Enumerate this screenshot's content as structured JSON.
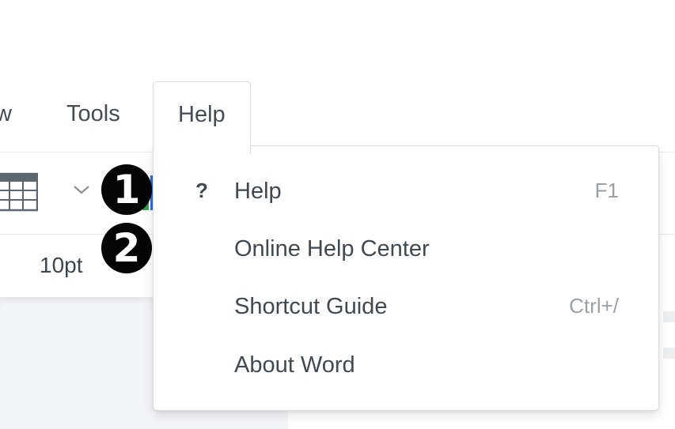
{
  "menubar": {
    "view_partial": "w",
    "tools": "Tools",
    "help": "Help"
  },
  "toolbar": {
    "icons": [
      "table-icon",
      "chevron-down-icon",
      "partial-icon"
    ]
  },
  "format": {
    "font_size": "10pt"
  },
  "badges": [
    "1",
    "2"
  ],
  "help_menu": {
    "items": [
      {
        "label": "Help",
        "shortcut": "F1",
        "icon": "?"
      },
      {
        "label": "Online Help Center",
        "shortcut": ""
      },
      {
        "label": "Shortcut Guide",
        "shortcut": "Ctrl+/"
      },
      {
        "label": "About Word",
        "shortcut": ""
      }
    ]
  },
  "colors": {
    "text": "#414950",
    "shortcut": "#9aa0a6",
    "border": "#d9dcdf",
    "badge": "#050505",
    "doc_background": "#f3f4f6"
  }
}
